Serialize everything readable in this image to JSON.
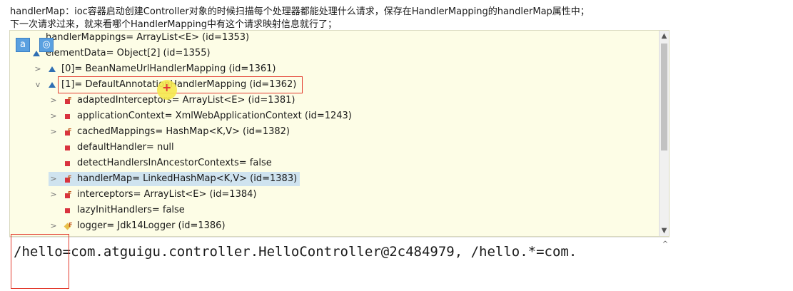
{
  "notes": {
    "line1": "handlerMap：ioc容器启动创建Controller对象的时候扫描每个处理器都能处理什么请求，保存在HandlerMapping的handlerMap属性中；",
    "line2": "下一次请求过来，就来看哪个HandlerMapping中有这个请求映射信息就行了；"
  },
  "tree": {
    "rows": [
      {
        "text": "handlerMappings= ArrayList<E>  (id=1353)"
      },
      {
        "text": "elementData= Object[2]  (id=1355)"
      },
      {
        "text": "[0]= BeanNameUrlHandlerMapping  (id=1361)"
      },
      {
        "text": "[1]= DefaultAnnotationHandlerMapping  (id=1362)"
      },
      {
        "text": "adaptedInterceptors= ArrayList<E>  (id=1381)"
      },
      {
        "text": "applicationContext= XmlWebApplicationContext  (id=1243)"
      },
      {
        "text": "cachedMappings= HashMap<K,V>  (id=1382)"
      },
      {
        "text": "defaultHandler= null"
      },
      {
        "text": "detectHandlersInAncestorContexts= false"
      },
      {
        "text": "handlerMap= LinkedHashMap<K,V>  (id=1383)"
      },
      {
        "text": "interceptors= ArrayList<E>  (id=1384)"
      },
      {
        "text": "lazyInitHandlers= false"
      },
      {
        "text": "logger= Jdk14Logger  (id=1386)"
      }
    ]
  },
  "toolbar": {
    "a_label": "a",
    "eye_label": "◎"
  },
  "detail": {
    "text": "/hello=com.atguigu.controller.HelloController@2c484979, /hello.*=com."
  },
  "icons": {
    "expand": "chevron-right-icon",
    "collapse": "chevron-down-icon",
    "object": "blue-triangle-icon",
    "field": "red-square-icon",
    "final_field": "red-square-final-icon",
    "static_field": "yellow-diamond-static-icon"
  },
  "colors": {
    "panel_bg": "#fdfde6",
    "highlight_bg": "#cfe3ef",
    "annotation_red": "#e33b2e",
    "tree_blue": "#2f6fb3"
  }
}
